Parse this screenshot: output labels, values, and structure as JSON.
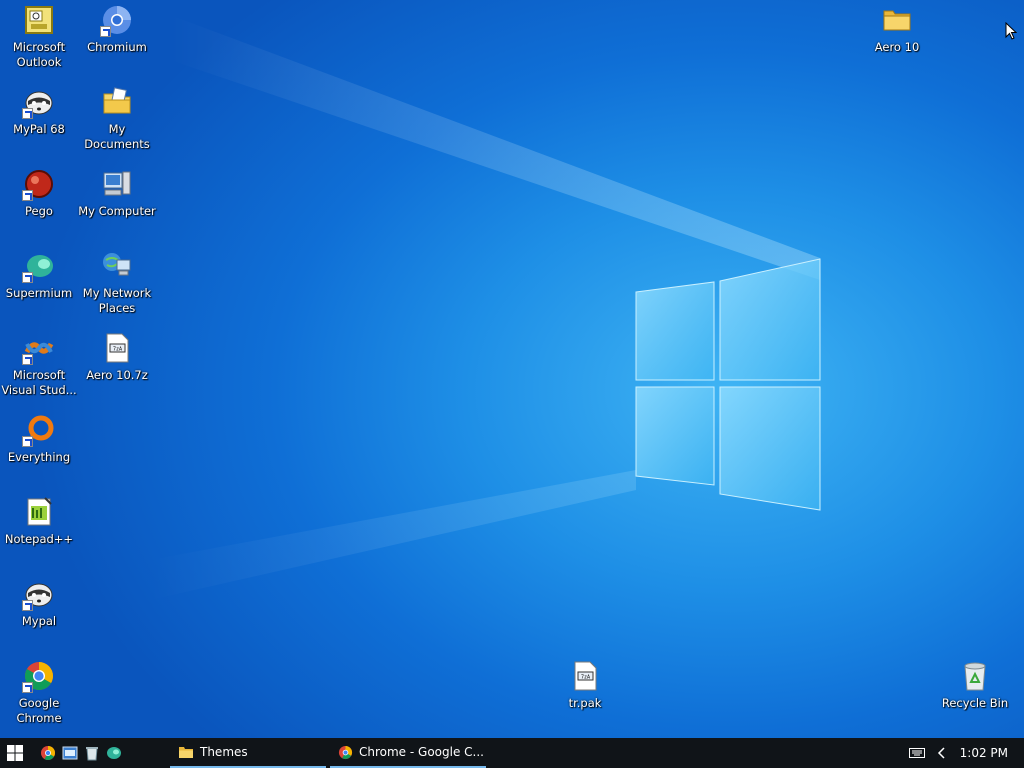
{
  "desktop_icons": {
    "outlook": "Microsoft Outlook",
    "chromium": "Chromium",
    "aero10_folder": "Aero 10",
    "mypal68": "MyPal 68",
    "my_documents": "My Documents",
    "pego": "Pego",
    "my_computer": "My Computer",
    "supermium": "Supermium",
    "network_places": "My Network Places",
    "vs": "Microsoft Visual Stud...",
    "aero_7z": "Aero 10.7z",
    "everything": "Everything",
    "notepadpp": "Notepad++",
    "mypal": "Mypal",
    "chrome": "Google Chrome",
    "trpak": "tr.pak",
    "recycle_bin": "Recycle Bin"
  },
  "taskbar": {
    "tasks": [
      {
        "label": "Themes",
        "icon": "folder-icon"
      },
      {
        "label": "Chrome - Google C...",
        "icon": "chrome-icon"
      }
    ],
    "clock": "1:02 PM"
  },
  "colors": {
    "desktop_blue": "#1e8fe6",
    "taskbar_bg": "#101418",
    "task_accent": "#76b9ed"
  }
}
